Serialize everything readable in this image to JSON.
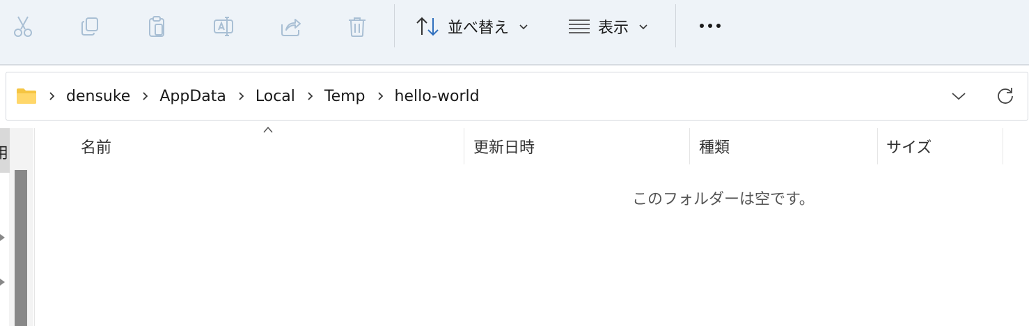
{
  "toolbar": {
    "cut_icon": "scissors-icon",
    "copy_icon": "copy-icon",
    "paste_icon": "paste-icon",
    "rename_icon": "rename-icon",
    "share_icon": "share-icon",
    "delete_icon": "trash-icon",
    "sort_label": "並べ替え",
    "view_label": "表示",
    "more_icon": "more-icon"
  },
  "address": {
    "folder_icon": "folder-icon",
    "crumbs": [
      "densuke",
      "AppData",
      "Local",
      "Temp",
      "hello-world"
    ]
  },
  "nav": {
    "selected_partial": "用"
  },
  "list": {
    "columns": [
      "名前",
      "更新日時",
      "種類",
      "サイズ"
    ],
    "empty_message": "このフォルダーは空です。"
  },
  "colors": {
    "toolbar_bg": "#eef3f8",
    "disabled_icon": "#a9bfd4",
    "accent_blue": "#2f6fbd",
    "folder_yellow": "#f5c542"
  }
}
